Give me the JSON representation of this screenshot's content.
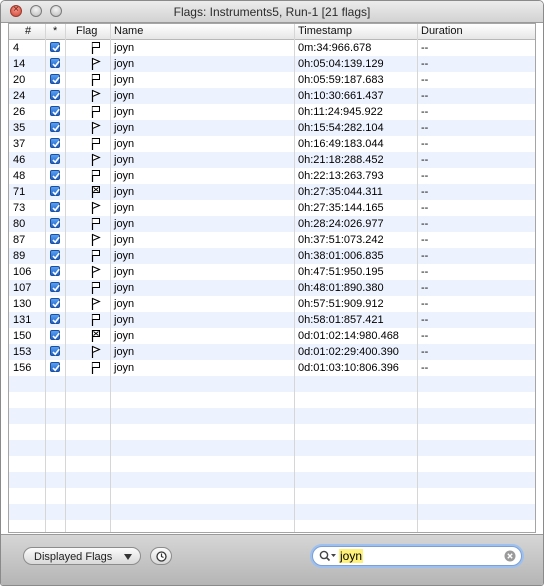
{
  "window": {
    "title": "Flags: Instruments5, Run-1  [21 flags]"
  },
  "table": {
    "columns": {
      "num": "#",
      "checked": "*",
      "flag": "Flag",
      "name": "Name",
      "timestamp": "Timestamp",
      "duration": "Duration"
    },
    "rows": [
      {
        "num": "4",
        "flag": "start",
        "name": "joyn",
        "timestamp": "0m:34:966.678",
        "duration": "--"
      },
      {
        "num": "14",
        "flag": "end",
        "name": "joyn",
        "timestamp": "0h:05:04:139.129",
        "duration": "--"
      },
      {
        "num": "20",
        "flag": "start",
        "name": "joyn",
        "timestamp": "0h:05:59:187.683",
        "duration": "--"
      },
      {
        "num": "24",
        "flag": "end",
        "name": "joyn",
        "timestamp": "0h:10:30:661.437",
        "duration": "--"
      },
      {
        "num": "26",
        "flag": "start",
        "name": "joyn",
        "timestamp": "0h:11:24:945.922",
        "duration": "--"
      },
      {
        "num": "35",
        "flag": "end",
        "name": "joyn",
        "timestamp": "0h:15:54:282.104",
        "duration": "--"
      },
      {
        "num": "37",
        "flag": "start",
        "name": "joyn",
        "timestamp": "0h:16:49:183.044",
        "duration": "--"
      },
      {
        "num": "46",
        "flag": "end",
        "name": "joyn",
        "timestamp": "0h:21:18:288.452",
        "duration": "--"
      },
      {
        "num": "48",
        "flag": "start",
        "name": "joyn",
        "timestamp": "0h:22:13:263.793",
        "duration": "--"
      },
      {
        "num": "71",
        "flag": "x",
        "name": "joyn",
        "timestamp": "0h:27:35:044.311",
        "duration": "--"
      },
      {
        "num": "73",
        "flag": "end",
        "name": "joyn",
        "timestamp": "0h:27:35:144.165",
        "duration": "--"
      },
      {
        "num": "80",
        "flag": "start",
        "name": "joyn",
        "timestamp": "0h:28:24:026.977",
        "duration": "--"
      },
      {
        "num": "87",
        "flag": "end",
        "name": "joyn",
        "timestamp": "0h:37:51:073.242",
        "duration": "--"
      },
      {
        "num": "89",
        "flag": "start",
        "name": "joyn",
        "timestamp": "0h:38:01:006.835",
        "duration": "--"
      },
      {
        "num": "106",
        "flag": "end",
        "name": "joyn",
        "timestamp": "0h:47:51:950.195",
        "duration": "--"
      },
      {
        "num": "107",
        "flag": "start",
        "name": "joyn",
        "timestamp": "0h:48:01:890.380",
        "duration": "--"
      },
      {
        "num": "130",
        "flag": "end",
        "name": "joyn",
        "timestamp": "0h:57:51:909.912",
        "duration": "--"
      },
      {
        "num": "131",
        "flag": "start",
        "name": "joyn",
        "timestamp": "0h:58:01:857.421",
        "duration": "--"
      },
      {
        "num": "150",
        "flag": "x",
        "name": "joyn",
        "timestamp": "0d:01:02:14:980.468",
        "duration": "--"
      },
      {
        "num": "153",
        "flag": "end",
        "name": "joyn",
        "timestamp": "0d:01:02:29:400.390",
        "duration": "--"
      },
      {
        "num": "156",
        "flag": "start",
        "name": "joyn",
        "timestamp": "0d:01:03:10:806.396",
        "duration": "--"
      }
    ]
  },
  "footer": {
    "displayed_flags_label": "Displayed Flags",
    "search_value": "joyn",
    "search_icon": "magnifier-icon",
    "clear_icon": "clear-circle-icon",
    "clock_icon": "clock-icon"
  }
}
